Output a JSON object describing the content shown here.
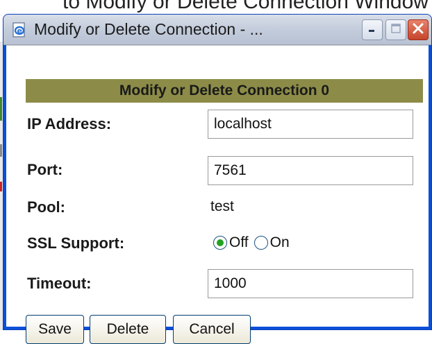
{
  "background": {
    "title_partial": "to Modify or Delete Connection Window"
  },
  "window": {
    "title": "Modify or Delete Connection - ...",
    "icon": "ie-page-icon",
    "controls": {
      "minimize_icon": "minimize-icon",
      "maximize_icon": "maximize-icon",
      "close_icon": "close-icon"
    }
  },
  "form": {
    "header": "Modify or Delete Connection 0",
    "ip_address": {
      "label": "IP Address:",
      "value": "localhost"
    },
    "port": {
      "label": "Port:",
      "value": "7561"
    },
    "pool": {
      "label": "Pool:",
      "value": "test"
    },
    "ssl": {
      "label": "SSL Support:",
      "options": [
        {
          "label": "Off",
          "selected": true
        },
        {
          "label": "On",
          "selected": false
        }
      ]
    },
    "timeout": {
      "label": "Timeout:",
      "value": "1000"
    }
  },
  "buttons": {
    "save": "Save",
    "delete": "Delete",
    "cancel": "Cancel"
  },
  "colors": {
    "header_bg": "#8c8c48",
    "titlebar_blue": "#0a4fd8",
    "close_red": "#c5452c",
    "radio_selected": "#22a222"
  }
}
